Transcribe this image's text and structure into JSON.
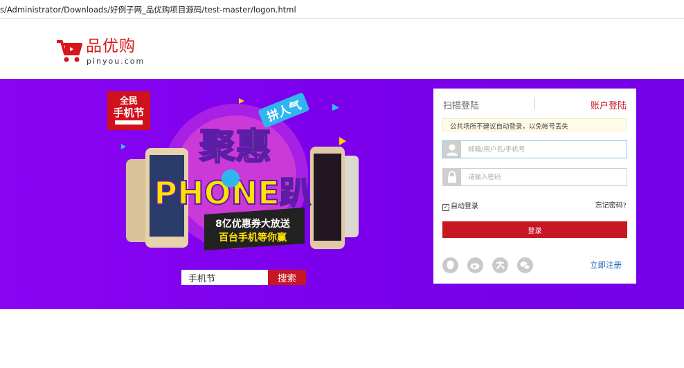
{
  "browser": {
    "url": "s/Administrator/Downloads/好例子网_品优购项目源码/test-master/logon.html"
  },
  "logo": {
    "name": "品优购",
    "domain": "pinyou.com"
  },
  "promo": {
    "badge_line1": "全民",
    "badge_line2": "手机节",
    "tag": "拼人气",
    "headline": "聚惠",
    "phone_text": "PHONE趴",
    "ribbon_line1": "8亿优惠券大放送",
    "ribbon_line2": "百台手机等你赢"
  },
  "search": {
    "value": "手机节",
    "button": "搜索"
  },
  "login": {
    "tab_scan": "扫描登陆",
    "tab_account": "账户登陆",
    "notice": "公共场所不建议自动登录，以免帐号丢失",
    "username_placeholder": "邮箱/用户名/手机号",
    "password_placeholder": "请输入密码",
    "auto_login": "自动登录",
    "forgot": "忘记密码?",
    "submit": "登录",
    "register": "立即注册",
    "social": [
      "qq-icon",
      "weibo-icon",
      "alipay-icon",
      "wechat-icon"
    ]
  },
  "colors": {
    "brand_red": "#c81623",
    "band_purple": "#7d00ec",
    "link_blue": "#1f66b8"
  }
}
